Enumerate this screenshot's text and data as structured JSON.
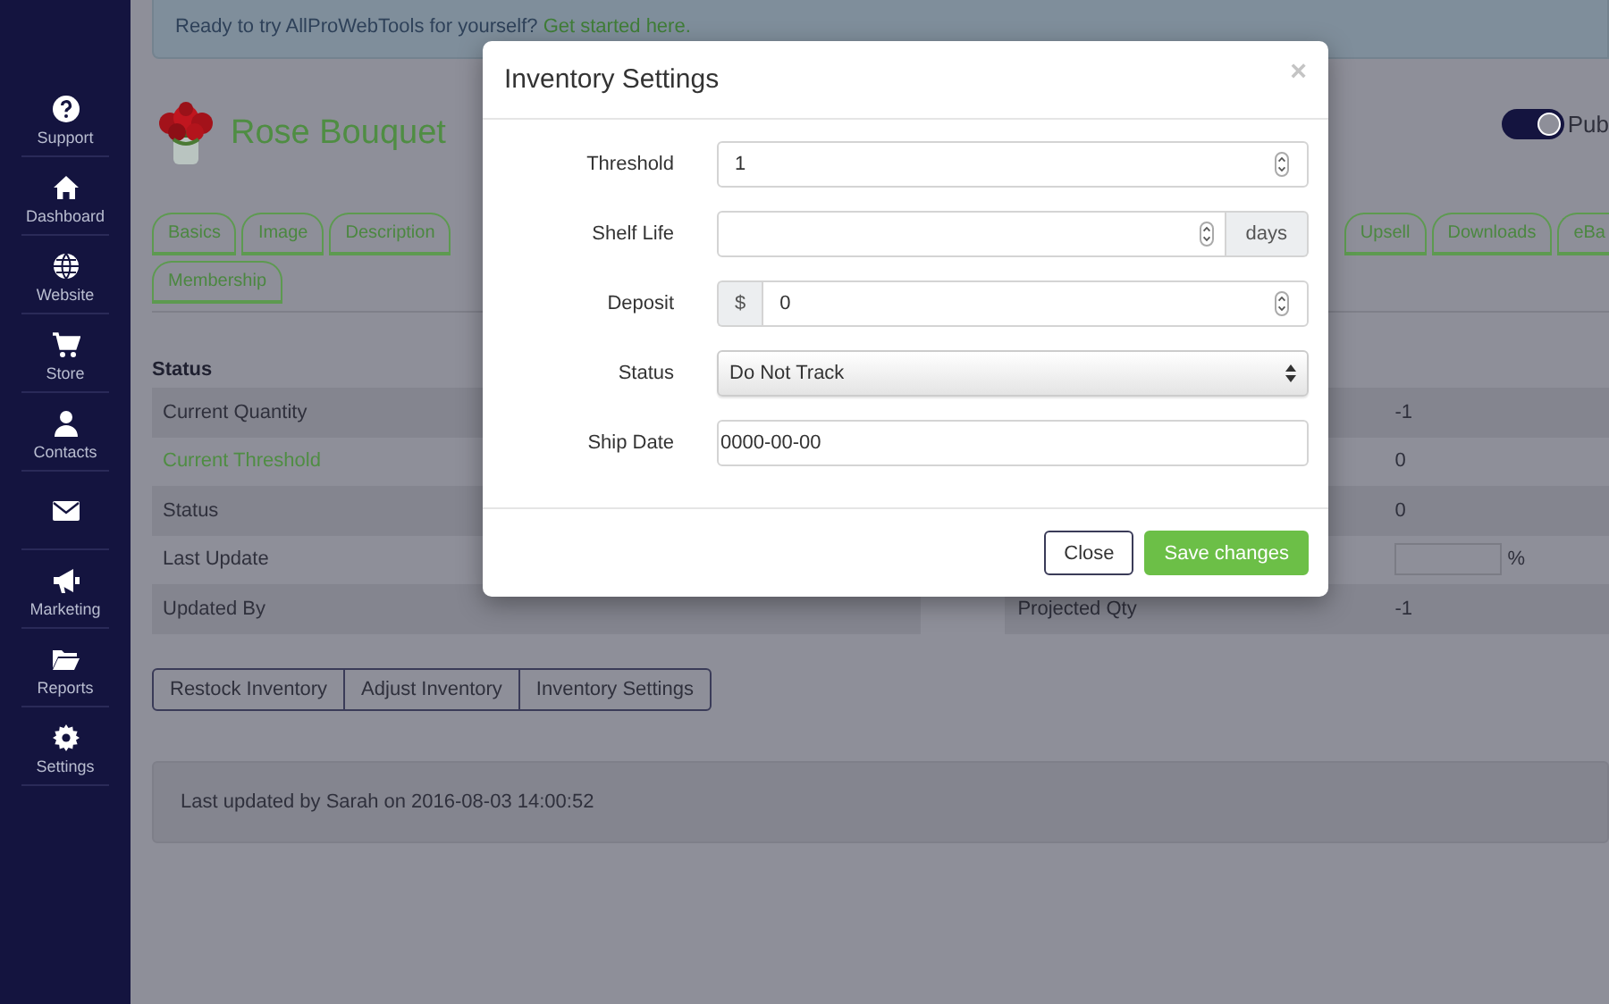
{
  "sidebar": {
    "items": [
      {
        "kind": "labeled",
        "label": "Support"
      },
      {
        "kind": "labeled",
        "label": "Dashboard"
      },
      {
        "kind": "labeled",
        "label": "Website"
      },
      {
        "kind": "labeled",
        "label": "Store"
      },
      {
        "kind": "labeled",
        "label": "Contacts"
      },
      {
        "kind": "icon"
      },
      {
        "kind": "labeled",
        "label": "Marketing"
      },
      {
        "kind": "labeled",
        "label": "Reports"
      },
      {
        "kind": "labeled",
        "label": "Settings"
      }
    ]
  },
  "banner": {
    "text": "Ready to try AllProWebTools for yourself?",
    "link": "Get started here."
  },
  "product": {
    "title": "Rose Bouquet",
    "published": true,
    "toggle_label": "Pub"
  },
  "tab_rows": [
    {
      "left": [
        "Basics",
        "Image",
        "Description"
      ],
      "right": [
        "Upsell",
        "Downloads",
        "eBa"
      ]
    },
    {
      "left": [
        "Membership"
      ]
    }
  ],
  "status_table": {
    "heading": "Status",
    "rows": [
      {
        "label": "Current Quantity",
        "kind": "plain"
      },
      {
        "label": "Current Threshold",
        "kind": "link"
      },
      {
        "label": "Status",
        "kind": "plain"
      },
      {
        "label": "Last Update",
        "kind": "plain"
      },
      {
        "label": "Updated By",
        "kind": "plain"
      }
    ]
  },
  "side_table": {
    "rows": [
      {
        "kind": "text",
        "value": "-1"
      },
      {
        "kind": "text",
        "value": "0"
      },
      {
        "kind": "text",
        "value": "0"
      },
      {
        "kind": "input",
        "unit": "%"
      },
      {
        "kind": "text",
        "label": "Projected Qty",
        "value": "-1"
      }
    ]
  },
  "actions": [
    "Restock Inventory",
    "Adjust Inventory",
    "Inventory Settings"
  ],
  "footer": "Last updated by Sarah on 2016-08-03 14:00:52",
  "modal": {
    "title": "Inventory Settings",
    "close": "×",
    "fields": [
      {
        "label": "Threshold",
        "kind": "number",
        "value": "1"
      },
      {
        "label": "Shelf Life",
        "kind": "number",
        "suffix": "days"
      },
      {
        "label": "Deposit",
        "kind": "number",
        "prefix": "$",
        "value": "0"
      },
      {
        "label": "Status",
        "kind": "select",
        "value": "Do Not Track"
      },
      {
        "label": "Ship Date",
        "kind": "text",
        "value": "0000-00-00"
      }
    ],
    "buttons": [
      {
        "label": "Close",
        "kind": "default"
      },
      {
        "label": "Save changes",
        "kind": "primary"
      }
    ]
  }
}
